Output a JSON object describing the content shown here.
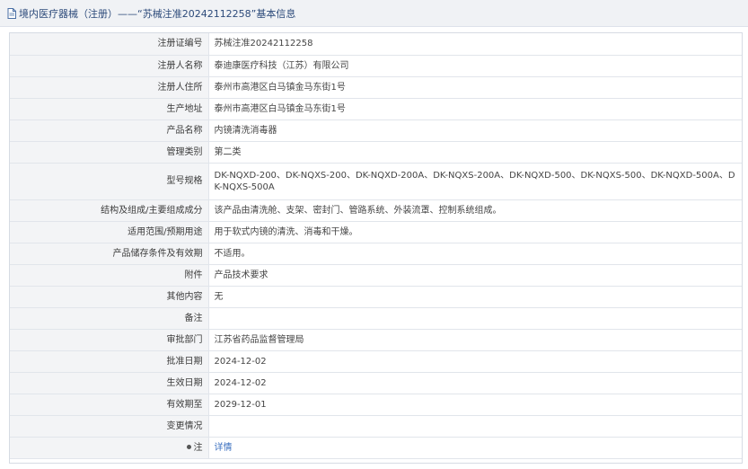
{
  "header": {
    "title": "境内医疗器械（注册）——“苏械注准20242112258”基本信息"
  },
  "rows": [
    {
      "label": "注册证编号",
      "value": "苏械注准20242112258"
    },
    {
      "label": "注册人名称",
      "value": "泰迪康医疗科技（江苏）有限公司"
    },
    {
      "label": "注册人住所",
      "value": "泰州市高港区白马镇金马东街1号"
    },
    {
      "label": "生产地址",
      "value": "泰州市高港区白马镇金马东街1号"
    },
    {
      "label": "产品名称",
      "value": "内镜清洗消毒器"
    },
    {
      "label": "管理类别",
      "value": "第二类"
    },
    {
      "label": "型号规格",
      "value": "DK-NQXD-200、DK-NQXS-200、DK-NQXD-200A、DK-NQXS-200A、DK-NQXD-500、DK-NQXS-500、DK-NQXD-500A、DK-NQXS-500A"
    },
    {
      "label": "结构及组成/主要组成成分",
      "value": "该产品由清洗舱、支架、密封门、管路系统、外装流罩、控制系统组成。"
    },
    {
      "label": "适用范围/预期用途",
      "value": "用于软式内镜的清洗、消毒和干燥。"
    },
    {
      "label": "产品储存条件及有效期",
      "value": "不适用。"
    },
    {
      "label": "附件",
      "value": "产品技术要求"
    },
    {
      "label": "其他内容",
      "value": "无"
    },
    {
      "label": "备注",
      "value": ""
    },
    {
      "label": "审批部门",
      "value": "江苏省药品监督管理局"
    },
    {
      "label": "批准日期",
      "value": "2024-12-02"
    },
    {
      "label": "生效日期",
      "value": "2024-12-02"
    },
    {
      "label": "有效期至",
      "value": "2029-12-01"
    },
    {
      "label": "变更情况",
      "value": ""
    }
  ],
  "note": {
    "label": "注",
    "link": "详情"
  },
  "colors": {
    "link": "#3a6fbf",
    "title": "#2c4a7a",
    "label_bg": "#f3f4f6"
  }
}
